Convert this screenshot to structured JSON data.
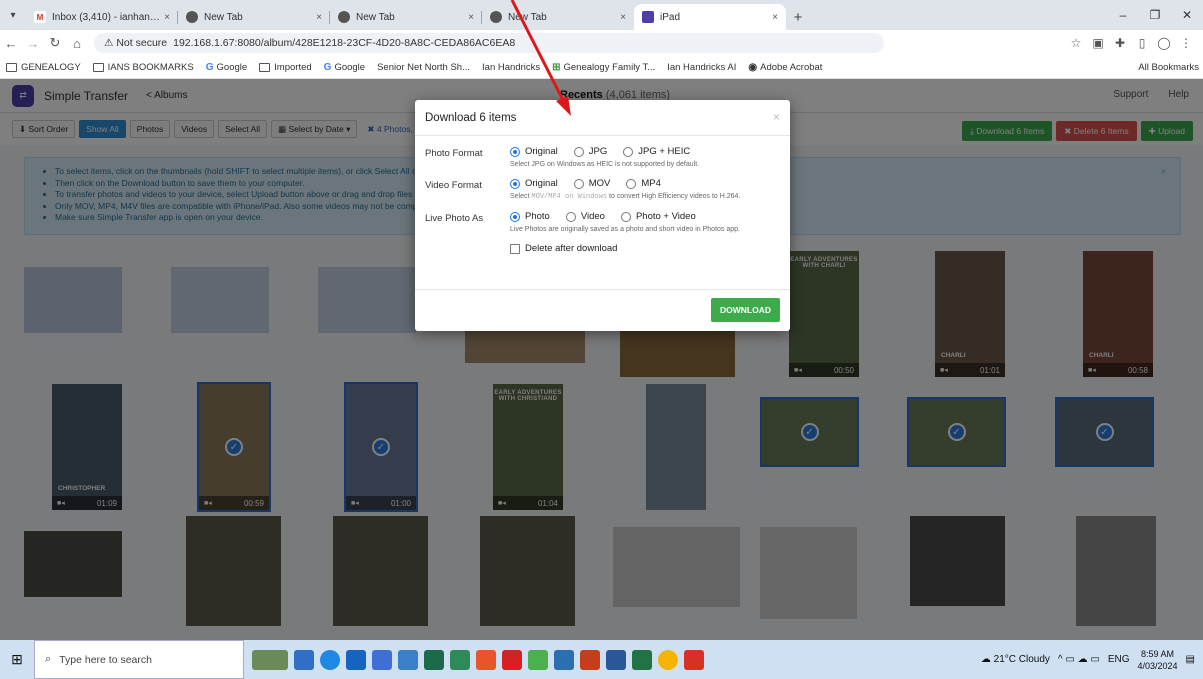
{
  "browser": {
    "tabs": [
      {
        "title": "Inbox (3,410) - ianhandricks@",
        "icon": "gmail-icon",
        "active": false
      },
      {
        "title": "New Tab",
        "icon": "chrome-icon",
        "active": false
      },
      {
        "title": "New Tab",
        "icon": "chrome-icon",
        "active": false
      },
      {
        "title": "New Tab",
        "icon": "chrome-icon",
        "active": false
      },
      {
        "title": "iPad",
        "icon": "simple-transfer-icon",
        "active": true
      }
    ],
    "new_tab": "+",
    "security_label": "Not secure",
    "url": "192.168.1.67:8080/album/428E1218-23CF-4D20-8A8C-CEDA86AC6EA8",
    "bookmarks": [
      "GENEALOGY",
      "IANS BOOKMARKS",
      "Google",
      "Imported",
      "Google",
      "Senior Net North Sh...",
      "Ian Handricks",
      "Genealogy Family T...",
      "Ian Handricks AI",
      "Adobe Acrobat"
    ],
    "all_bookmarks": "All Bookmarks"
  },
  "app": {
    "title": "Simple Transfer",
    "back_label": "Albums",
    "album_title": "Recents",
    "album_count": "(4,061 items)",
    "support": "Support",
    "help": "Help",
    "toolbar": {
      "sort_order": "Sort Order",
      "show_all": "Show All",
      "photos": "Photos",
      "videos": "Videos",
      "select_all": "Select All",
      "select_by_date": "Select by Date",
      "selection_info": "4 Photos, 2 Videos selected",
      "download_items": "Download 6 Items",
      "delete_items": "Delete 6 Items",
      "upload": "Upload"
    },
    "info_lines": [
      "To select items, click on the thumbnails (hold SHIFT to select multiple items), or click Select All or Select",
      "Then click on the Download button to save them to your computer.",
      "To transfer photos and videos to your device, select Upload button above or drag and drop files from your c",
      "Only MOV, MP4, M4V files are compatible with iPhone/iPad. Also some videos may not be compatible",
      "Make sure Simple Transfer app is open on your device."
    ],
    "thumb_labels": {
      "durations": [
        "00:50",
        "01:01",
        "00:58",
        "01:09",
        "00:59",
        "01:00",
        "01:04"
      ],
      "early_adventures": "EARLY ADVENTURES WITH CHARLI",
      "early_adventures_2": "EARLY ADVENTURES WITH CHRISTIAND",
      "charli": "CHARLI",
      "christopher": "CHRISTOPHER"
    }
  },
  "modal": {
    "title": "Download 6 items",
    "close": "×",
    "photo_format": {
      "label": "Photo Format",
      "options": [
        "Original",
        "JPG",
        "JPG + HEIC"
      ],
      "selected": "Original",
      "hint": "Select JPG on Windows as HEIC is not supported by default."
    },
    "video_format": {
      "label": "Video Format",
      "options": [
        "Original",
        "MOV",
        "MP4"
      ],
      "selected": "Original",
      "hint_pre": "Select",
      "hint_code": "MOV/MP4 on Windows",
      "hint_post": "to convert High Efficiency videos to H.264."
    },
    "live_photo": {
      "label": "Live Photo As",
      "options": [
        "Photo",
        "Video",
        "Photo + Video"
      ],
      "selected": "Photo",
      "hint": "Live Photos are originally saved as a photo and short video in Photos app."
    },
    "delete_after": "Delete after download",
    "download_button": "DOWNLOAD"
  },
  "taskbar": {
    "search_placeholder": "Type here to search",
    "weather": "21°C  Cloudy",
    "lang": "ENG",
    "time": "8:59 AM",
    "date": "4/03/2024"
  },
  "colors": {
    "accent": "#1a73e8",
    "download_green": "#3bab4c",
    "delete_red": "#d9534f",
    "annotation_arrow": "#e0171a"
  }
}
